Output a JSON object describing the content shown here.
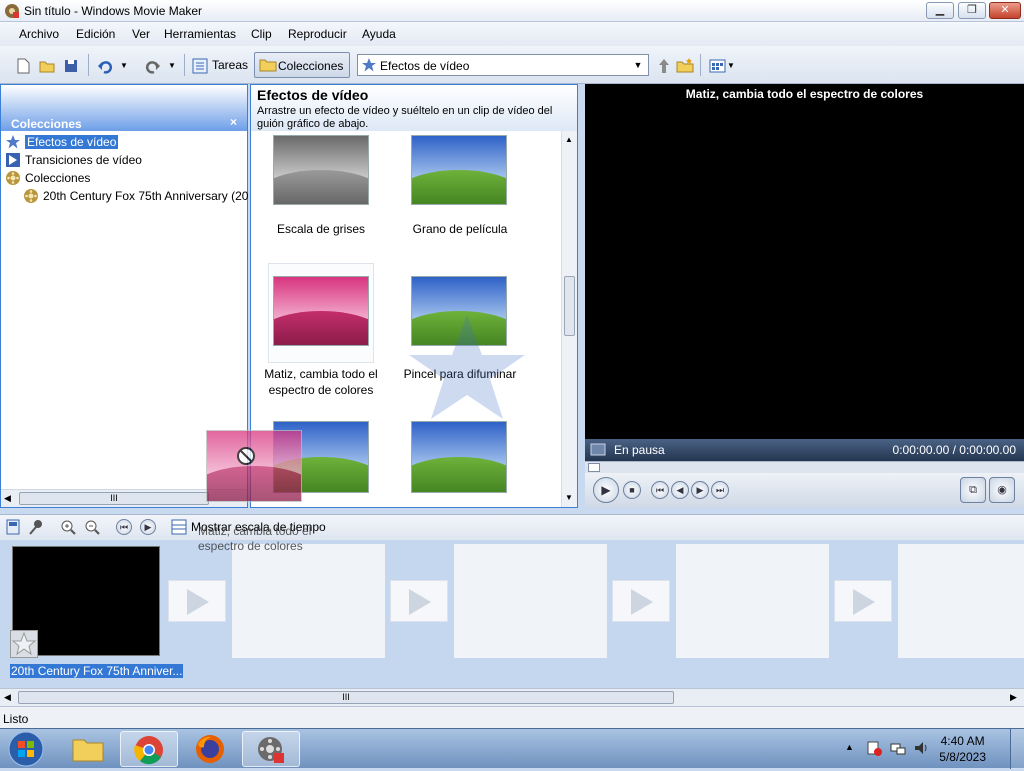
{
  "window": {
    "title": "Sin título - Windows Movie Maker",
    "min_glyph": "▁",
    "max_glyph": "❐",
    "close_glyph": "✕"
  },
  "menu": [
    "Archivo",
    "Edición",
    "Ver",
    "Herramientas",
    "Clip",
    "Reproducir",
    "Ayuda"
  ],
  "toolbar": {
    "tareas_label": "Tareas",
    "colecciones_label": "Colecciones",
    "combo_value": "Efectos de vídeo"
  },
  "collections_pane": {
    "title": "Colecciones",
    "close_glyph": "×",
    "items": [
      {
        "label": "Efectos de vídeo",
        "icon": "star-icon"
      },
      {
        "label": "Transiciones de vídeo",
        "icon": "transition-icon"
      },
      {
        "label": "Colecciones",
        "icon": "film-reel-icon"
      },
      {
        "label": "20th Century Fox 75th Anniversary (20",
        "icon": "film-reel-icon"
      }
    ],
    "hscroll_grip": "III"
  },
  "effects_pane": {
    "title": "Efectos de vídeo",
    "description": "Arrastre un efecto de vídeo y suéltelo en un clip de vídeo del guión gráfico de abajo.",
    "effects": [
      {
        "label": "Escala de grises",
        "style": "grayscale"
      },
      {
        "label": "Grano de película",
        "style": "normal"
      },
      {
        "label": "Matiz, cambia todo el espectro de colores",
        "style": "pink"
      },
      {
        "label": "Pincel para difuminar",
        "style": "normal"
      }
    ]
  },
  "preview": {
    "title": "Matiz, cambia todo el espectro de colores",
    "state": "En pausa",
    "time": "0:00:00.00 / 0:00:00.00"
  },
  "storyboard": {
    "show_timeline_label": "Mostrar escala de tiempo",
    "clip_label": "20th Century Fox 75th Anniver...",
    "hscroll_grip": "III"
  },
  "drag": {
    "caption": "Matiz, cambia todo el espectro de colores"
  },
  "status": "Listo",
  "taskbar": {
    "time": "4:40 AM",
    "date": "5/8/2023"
  },
  "colors": {
    "accent": "#3478d6",
    "preview_bg": "#000000",
    "storyboard_bg": "#c4d7ee"
  }
}
